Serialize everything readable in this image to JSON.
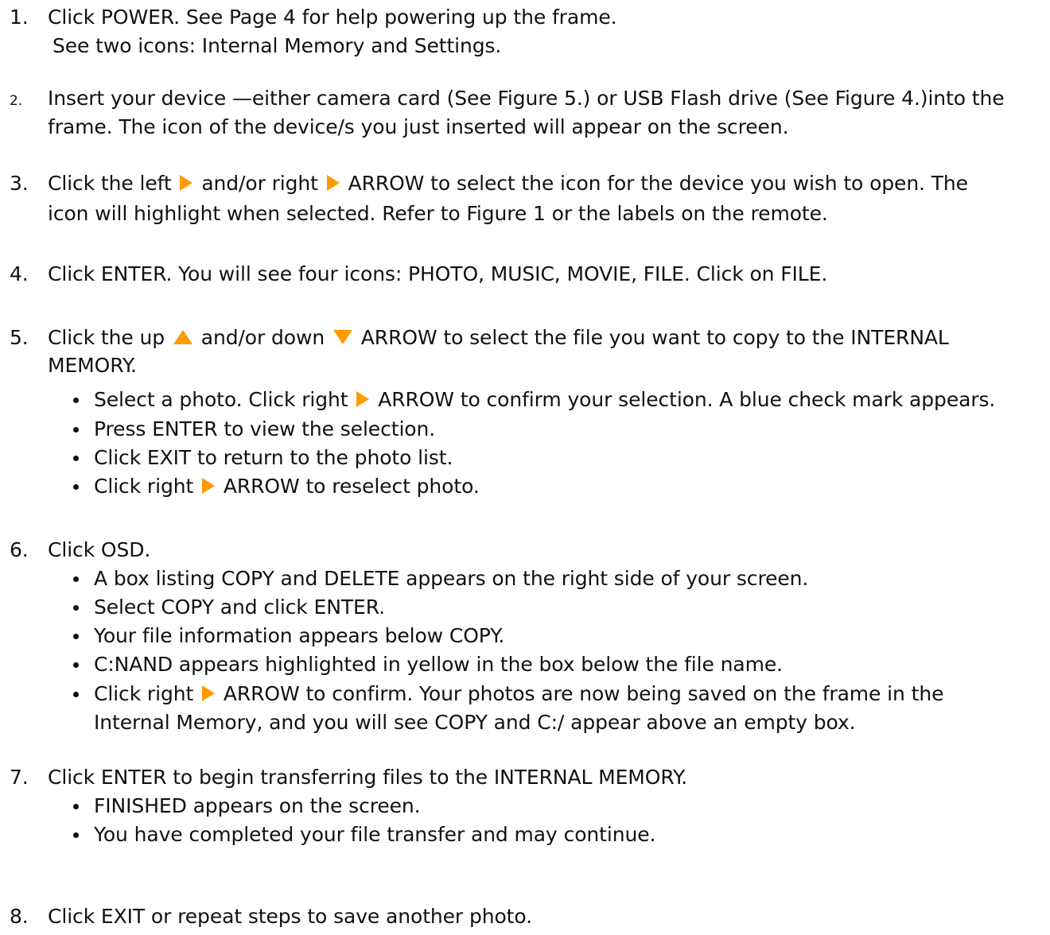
{
  "accent_color": "#FF9A00",
  "steps": [
    {
      "num": "1.",
      "parts": [
        "Click POWER. See Page 4 for help powering up the frame."
      ],
      "cont": "See two icons: Internal Memory and Settings."
    },
    {
      "num": "2.",
      "parts": [
        "Insert your device —either camera card (See Figure 5.) or USB Flash drive (See Figure 4.)into the"
      ],
      "cont": "frame. The icon of the device/s you just inserted will appear on the screen."
    },
    {
      "num": "3.",
      "parts": [
        "Click the left",
        "and/or right",
        "ARROW to select the icon for the device you wish to open. The"
      ],
      "cont": "icon will highlight when selected. Refer to Figure 1 or the labels on the remote."
    },
    {
      "num": "4.",
      "parts": [
        "Click ENTER.  You will see four icons: PHOTO, MUSIC, MOVIE, FILE. Click on FILE."
      ]
    },
    {
      "num": "5.",
      "parts": [
        "Click the up",
        "and/or down",
        "ARROW  to select the file you want to copy to the INTERNAL"
      ],
      "cont": "MEMORY.",
      "bullets": [
        {
          "parts": [
            "Select a photo. Click right",
            "ARROW to confirm your selection. A blue check mark appears."
          ]
        },
        {
          "parts": [
            "Press ENTER to view the selection."
          ]
        },
        {
          "parts": [
            "Click EXIT to return to the photo list."
          ]
        },
        {
          "parts": [
            "Click right",
            "ARROW to reselect photo."
          ]
        }
      ]
    },
    {
      "num": "6.",
      "parts": [
        "Click OSD."
      ],
      "bullets": [
        {
          "parts": [
            "A box listing COPY and DELETE appears on the right side of your screen."
          ]
        },
        {
          "parts": [
            "Select COPY and click ENTER."
          ]
        },
        {
          "parts": [
            "Your file information appears below COPY."
          ]
        },
        {
          "parts": [
            "C:NAND appears highlighted in yellow in the box below the file name."
          ]
        },
        {
          "parts": [
            "Click right",
            "ARROW to confirm. Your photos are now being saved on the frame in the"
          ],
          "cont": "Internal Memory, and you will see COPY and C:/ appear above an empty box."
        }
      ]
    },
    {
      "num": "7.",
      "parts": [
        "Click ENTER to begin transferring files to the INTERNAL MEMORY."
      ],
      "bullets": [
        {
          "parts": [
            "FINISHED appears on the screen."
          ]
        },
        {
          "parts": [
            "You have completed your file transfer and may continue."
          ]
        }
      ]
    },
    {
      "num": "8.",
      "parts": [
        "Click EXIT or repeat steps to save another photo."
      ]
    }
  ]
}
